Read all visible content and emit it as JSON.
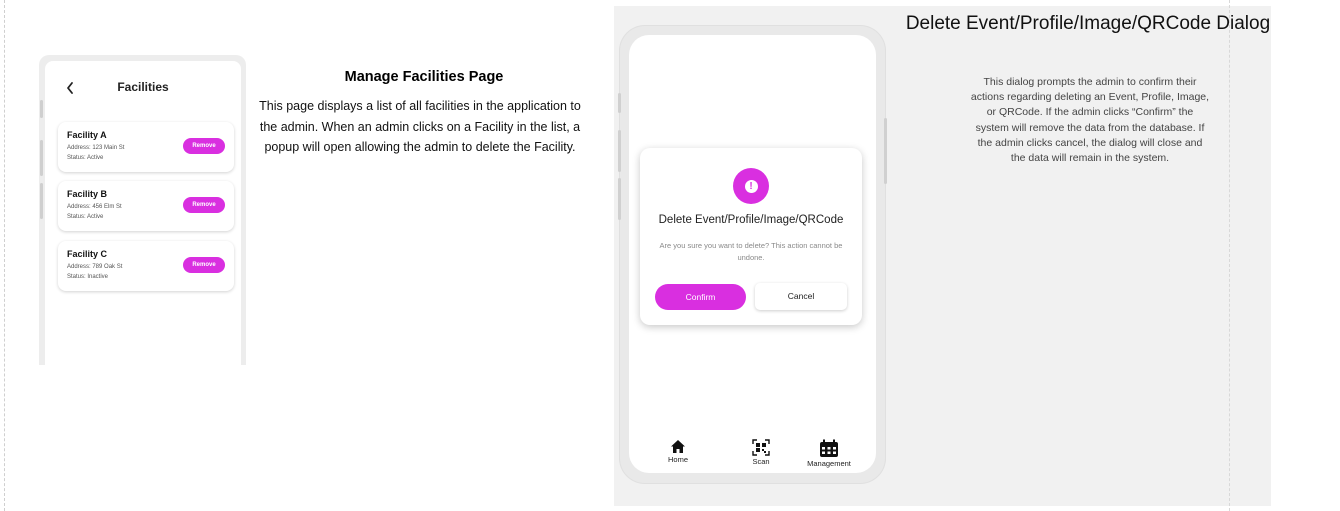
{
  "facilities_screen": {
    "title": "Facilities",
    "items": [
      {
        "name": "Facility A",
        "address": "Address: 123 Main St",
        "status": "Status: Active",
        "action": "Remove"
      },
      {
        "name": "Facility B",
        "address": "Address: 456 Elm St",
        "status": "Status: Active",
        "action": "Remove"
      },
      {
        "name": "Facility C",
        "address": "Address: 789 Oak St",
        "status": "Status: Inactive",
        "action": "Remove"
      }
    ]
  },
  "facilities_description": {
    "title": "Manage Facilities Page",
    "body": "This page displays a list of all facilities in the application to the admin. When an admin clicks on a Facility in the list, a popup will open allowing the admin to delete the Facility."
  },
  "dialog_screen": {
    "title": "Delete Event/Profile/Image/QRCode",
    "message": "Are you sure you want to delete? This action cannot be undone.",
    "confirm_label": "Confirm",
    "cancel_label": "Cancel",
    "nav": [
      {
        "label": "Home",
        "icon": "home-icon"
      },
      {
        "label": "Scan",
        "icon": "qr-scan-icon"
      },
      {
        "label": "Management",
        "icon": "calendar-icon"
      }
    ]
  },
  "dialog_description": {
    "title": "Delete Event/Profile/Image/QRCode Dialog",
    "body": "This dialog prompts the admin to confirm their actions regarding deleting an Event, Profile, Image, or QRCode. If the admin clicks “Confirm” the system will remove the data from the database. If the admin clicks cancel, the dialog will close and the data will remain in the system."
  },
  "colors": {
    "accent": "#d92fe0",
    "panel_background": "#f1f1f1"
  }
}
